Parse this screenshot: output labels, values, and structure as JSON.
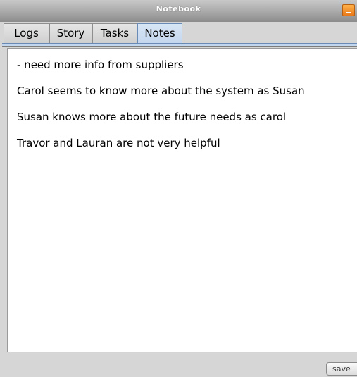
{
  "window": {
    "title": "Notebook"
  },
  "tabs": [
    {
      "label": "Logs",
      "active": false
    },
    {
      "label": "Story",
      "active": false
    },
    {
      "label": "Tasks",
      "active": false
    },
    {
      "label": "Notes",
      "active": true
    }
  ],
  "notes": {
    "lines": [
      "- need more info from suppliers",
      "Carol seems to know more about the system as Susan",
      "Susan knows more about the future needs as carol",
      "Travor and Lauran are not very helpful"
    ]
  },
  "footer": {
    "save_label": "save"
  },
  "colors": {
    "minimize_button": "#f08a24",
    "active_tab": "#c2d6ee"
  },
  "icons": {
    "minimize": "minimize-icon"
  }
}
